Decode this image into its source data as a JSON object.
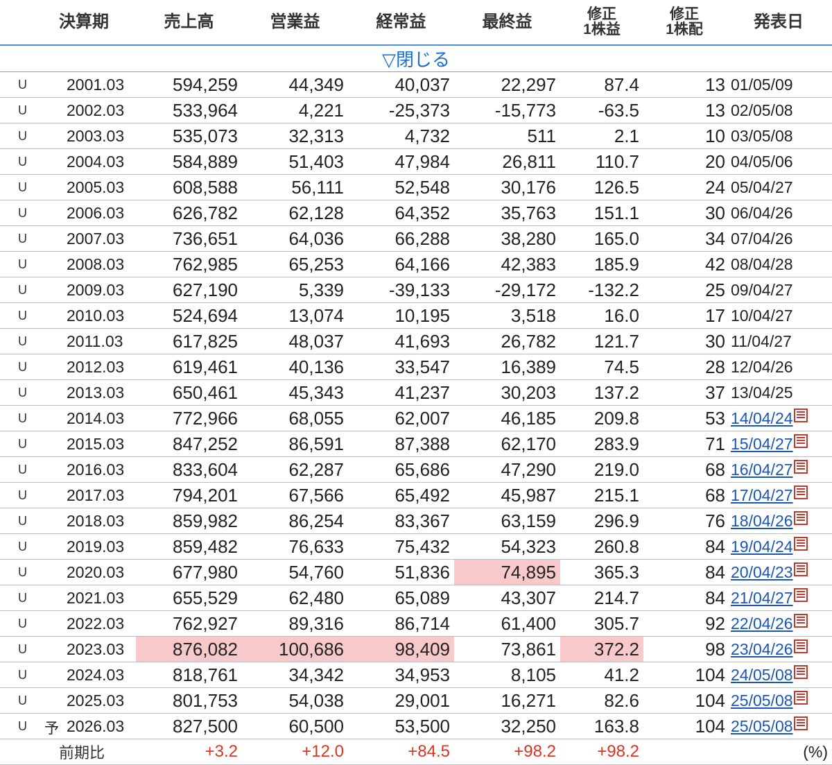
{
  "headers": [
    "決算期",
    "売上高",
    "営業益",
    "経常益",
    "最終益",
    "修正\n1株益",
    "修正\n1株配",
    "発表日"
  ],
  "toggle_label": "▽閉じる",
  "rows": [
    {
      "u": "U",
      "pre": "",
      "period": "2001.03",
      "sales": "594,259",
      "op": "44,349",
      "ord": "40,037",
      "net": "22,297",
      "eps": "87.4",
      "div": "13",
      "date": "01/05/09",
      "link": false,
      "hl": []
    },
    {
      "u": "U",
      "pre": "",
      "period": "2002.03",
      "sales": "533,964",
      "op": "4,221",
      "ord": "-25,373",
      "net": "-15,773",
      "eps": "-63.5",
      "div": "13",
      "date": "02/05/08",
      "link": false,
      "hl": []
    },
    {
      "u": "U",
      "pre": "",
      "period": "2003.03",
      "sales": "535,073",
      "op": "32,313",
      "ord": "4,732",
      "net": "511",
      "eps": "2.1",
      "div": "10",
      "date": "03/05/08",
      "link": false,
      "hl": []
    },
    {
      "u": "U",
      "pre": "",
      "period": "2004.03",
      "sales": "584,889",
      "op": "51,403",
      "ord": "47,984",
      "net": "26,811",
      "eps": "110.7",
      "div": "20",
      "date": "04/05/06",
      "link": false,
      "hl": []
    },
    {
      "u": "U",
      "pre": "",
      "period": "2005.03",
      "sales": "608,588",
      "op": "56,111",
      "ord": "52,548",
      "net": "30,176",
      "eps": "126.5",
      "div": "24",
      "date": "05/04/27",
      "link": false,
      "hl": []
    },
    {
      "u": "U",
      "pre": "",
      "period": "2006.03",
      "sales": "626,782",
      "op": "62,128",
      "ord": "64,352",
      "net": "35,763",
      "eps": "151.1",
      "div": "30",
      "date": "06/04/26",
      "link": false,
      "hl": []
    },
    {
      "u": "U",
      "pre": "",
      "period": "2007.03",
      "sales": "736,651",
      "op": "64,036",
      "ord": "66,288",
      "net": "38,280",
      "eps": "165.0",
      "div": "34",
      "date": "07/04/26",
      "link": false,
      "hl": []
    },
    {
      "u": "U",
      "pre": "",
      "period": "2008.03",
      "sales": "762,985",
      "op": "65,253",
      "ord": "64,166",
      "net": "42,383",
      "eps": "185.9",
      "div": "42",
      "date": "08/04/28",
      "link": false,
      "hl": []
    },
    {
      "u": "U",
      "pre": "",
      "period": "2009.03",
      "sales": "627,190",
      "op": "5,339",
      "ord": "-39,133",
      "net": "-29,172",
      "eps": "-132.2",
      "div": "25",
      "date": "09/04/27",
      "link": false,
      "hl": []
    },
    {
      "u": "U",
      "pre": "",
      "period": "2010.03",
      "sales": "524,694",
      "op": "13,074",
      "ord": "10,195",
      "net": "3,518",
      "eps": "16.0",
      "div": "17",
      "date": "10/04/27",
      "link": false,
      "hl": []
    },
    {
      "u": "U",
      "pre": "",
      "period": "2011.03",
      "sales": "617,825",
      "op": "48,037",
      "ord": "41,693",
      "net": "26,782",
      "eps": "121.7",
      "div": "30",
      "date": "11/04/27",
      "link": false,
      "hl": []
    },
    {
      "u": "U",
      "pre": "",
      "period": "2012.03",
      "sales": "619,461",
      "op": "40,136",
      "ord": "33,547",
      "net": "16,389",
      "eps": "74.5",
      "div": "28",
      "date": "12/04/26",
      "link": false,
      "hl": []
    },
    {
      "u": "U",
      "pre": "",
      "period": "2013.03",
      "sales": "650,461",
      "op": "45,343",
      "ord": "41,237",
      "net": "30,203",
      "eps": "137.2",
      "div": "37",
      "date": "13/04/25",
      "link": false,
      "hl": []
    },
    {
      "u": "U",
      "pre": "",
      "period": "2014.03",
      "sales": "772,966",
      "op": "68,055",
      "ord": "62,007",
      "net": "46,185",
      "eps": "209.8",
      "div": "53",
      "date": "14/04/24",
      "link": true,
      "hl": []
    },
    {
      "u": "U",
      "pre": "",
      "period": "2015.03",
      "sales": "847,252",
      "op": "86,591",
      "ord": "87,388",
      "net": "62,170",
      "eps": "283.9",
      "div": "71",
      "date": "15/04/27",
      "link": true,
      "hl": []
    },
    {
      "u": "U",
      "pre": "",
      "period": "2016.03",
      "sales": "833,604",
      "op": "62,287",
      "ord": "65,686",
      "net": "47,290",
      "eps": "219.0",
      "div": "68",
      "date": "16/04/27",
      "link": true,
      "hl": []
    },
    {
      "u": "U",
      "pre": "",
      "period": "2017.03",
      "sales": "794,201",
      "op": "67,566",
      "ord": "65,492",
      "net": "45,987",
      "eps": "215.1",
      "div": "68",
      "date": "17/04/27",
      "link": true,
      "hl": []
    },
    {
      "u": "U",
      "pre": "",
      "period": "2018.03",
      "sales": "859,982",
      "op": "86,254",
      "ord": "83,367",
      "net": "63,159",
      "eps": "296.9",
      "div": "76",
      "date": "18/04/26",
      "link": true,
      "hl": []
    },
    {
      "u": "U",
      "pre": "",
      "period": "2019.03",
      "sales": "859,482",
      "op": "76,633",
      "ord": "75,432",
      "net": "54,323",
      "eps": "260.8",
      "div": "84",
      "date": "19/04/24",
      "link": true,
      "hl": []
    },
    {
      "u": "U",
      "pre": "",
      "period": "2020.03",
      "sales": "677,980",
      "op": "54,760",
      "ord": "51,836",
      "net": "74,895",
      "eps": "365.3",
      "div": "84",
      "date": "20/04/23",
      "link": true,
      "hl": [
        "net"
      ]
    },
    {
      "u": "U",
      "pre": "",
      "period": "2021.03",
      "sales": "655,529",
      "op": "62,480",
      "ord": "65,089",
      "net": "43,307",
      "eps": "214.7",
      "div": "84",
      "date": "21/04/27",
      "link": true,
      "hl": []
    },
    {
      "u": "U",
      "pre": "",
      "period": "2022.03",
      "sales": "762,927",
      "op": "89,316",
      "ord": "86,714",
      "net": "61,400",
      "eps": "305.7",
      "div": "92",
      "date": "22/04/26",
      "link": true,
      "hl": []
    },
    {
      "u": "U",
      "pre": "",
      "period": "2023.03",
      "sales": "876,082",
      "op": "100,686",
      "ord": "98,409",
      "net": "73,861",
      "eps": "372.2",
      "div": "98",
      "date": "23/04/26",
      "link": true,
      "hl": [
        "sales",
        "op",
        "ord",
        "eps"
      ]
    },
    {
      "u": "U",
      "pre": "",
      "period": "2024.03",
      "sales": "818,761",
      "op": "34,342",
      "ord": "34,953",
      "net": "8,105",
      "eps": "41.2",
      "div": "104",
      "date": "24/05/08",
      "link": true,
      "hl": []
    },
    {
      "u": "U",
      "pre": "",
      "period": "2025.03",
      "sales": "801,753",
      "op": "54,038",
      "ord": "29,001",
      "net": "16,271",
      "eps": "82.6",
      "div": "104",
      "date": "25/05/08",
      "link": true,
      "hl": []
    },
    {
      "u": "U",
      "pre": "予",
      "period": "2026.03",
      "sales": "827,500",
      "op": "60,500",
      "ord": "53,500",
      "net": "32,250",
      "eps": "163.8",
      "div": "104",
      "date": "25/05/08",
      "link": true,
      "hl": []
    }
  ],
  "comparison": {
    "label": "前期比",
    "sales": "+3.2",
    "op": "+12.0",
    "ord": "+84.5",
    "net": "+98.2",
    "eps": "+98.2",
    "unit": "(%)"
  },
  "icons": {
    "pdf": "pdf-icon"
  },
  "colors": {
    "highlight": "#f7c9cb",
    "link": "#1a55b8",
    "positive": "#e0331f",
    "accent": "#4a90d9"
  }
}
